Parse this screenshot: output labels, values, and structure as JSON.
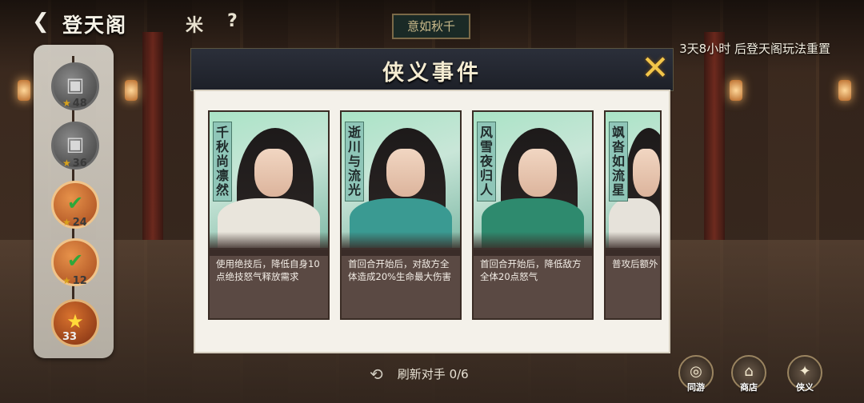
{
  "topbar": {
    "back_icon": "chevron-left-icon",
    "title": "登天阁",
    "icon1_glyph": "米",
    "help_glyph": "?",
    "sign_text": "意如秋千",
    "reset_text": "3天8小时 后登天阁玩法重置"
  },
  "rail": {
    "nodes": [
      {
        "state": "locked",
        "glyph": "▣",
        "count": "48"
      },
      {
        "state": "locked",
        "glyph": "▣",
        "count": "36"
      },
      {
        "state": "done",
        "glyph": "✔",
        "count": "24"
      },
      {
        "state": "done",
        "glyph": "✔",
        "count": "12"
      },
      {
        "state": "current",
        "glyph": "★",
        "count": "33"
      }
    ]
  },
  "modal": {
    "title": "侠义事件",
    "close_icon": "close-icon",
    "cards": [
      {
        "name": "千秋尚凛然",
        "desc": "使用绝技后，降低自身10点绝技怒气释放需求",
        "robe": "#e9e5dc"
      },
      {
        "name": "逝川与流光",
        "desc": "首回合开始后，对敌方全体造成20%生命最大伤害",
        "robe": "#3a9a92"
      },
      {
        "name": "风雪夜归人",
        "desc": "首回合开始后，降低敌方全体20点怒气",
        "robe": "#2e8a6e"
      },
      {
        "name": "飒沓如流星",
        "desc": "普攻后额外",
        "robe": "#e6e2da"
      }
    ]
  },
  "bottom": {
    "refresh_label": "刷新对手",
    "refresh_count": "0/6",
    "buttons": [
      {
        "label": "同游",
        "icon": "companion-icon"
      },
      {
        "label": "商店",
        "icon": "shop-icon"
      },
      {
        "label": "侠义",
        "icon": "chivalry-icon"
      }
    ]
  }
}
